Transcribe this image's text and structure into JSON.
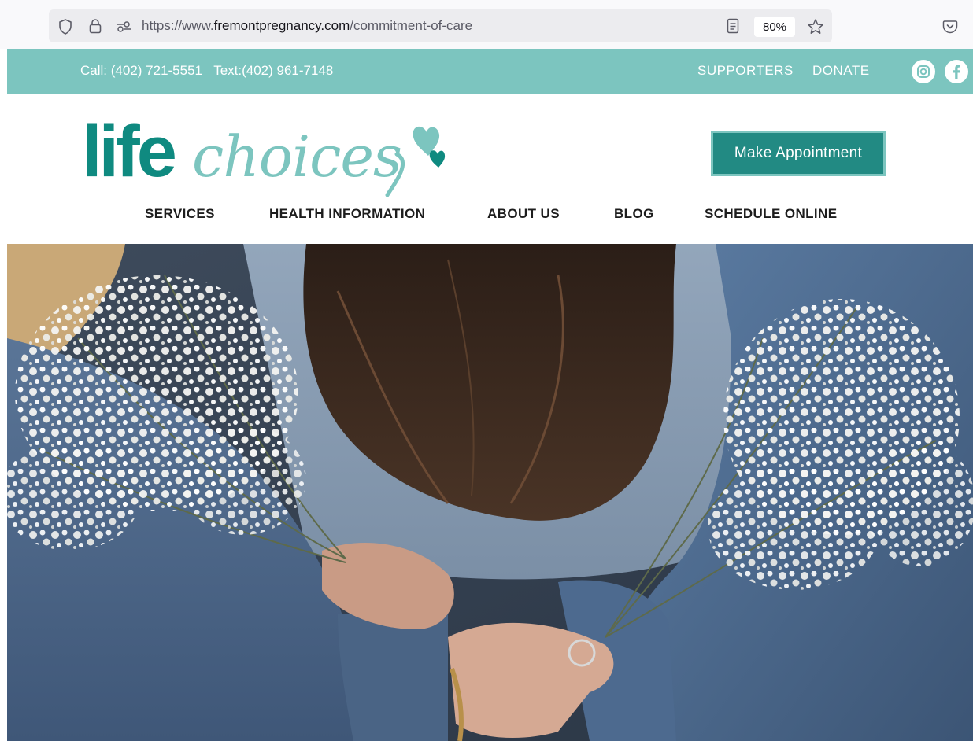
{
  "browser": {
    "url_prefix": "https://www.",
    "url_domain": "fremontpregnancy.com",
    "url_path": "/commitment-of-care",
    "zoom": "80%"
  },
  "topbar": {
    "call_label": "Call:",
    "call_number": "(402) 721-5551",
    "text_label": "Text:",
    "text_number": "(402) 961-7148",
    "supporters": "SUPPORTERS",
    "donate": "DONATE"
  },
  "header": {
    "logo_life": "life",
    "logo_choices": "choices",
    "appointment_button": "Make Appointment"
  },
  "nav": {
    "items": [
      "SERVICES",
      "HEALTH INFORMATION",
      "ABOUT US",
      "BLOG",
      "SCHEDULE ONLINE"
    ]
  },
  "colors": {
    "teal_bar": "#7cc5bf",
    "teal_dark": "#0f8a80",
    "teal_button": "#228a83",
    "teal_light": "#7cc5bf"
  }
}
